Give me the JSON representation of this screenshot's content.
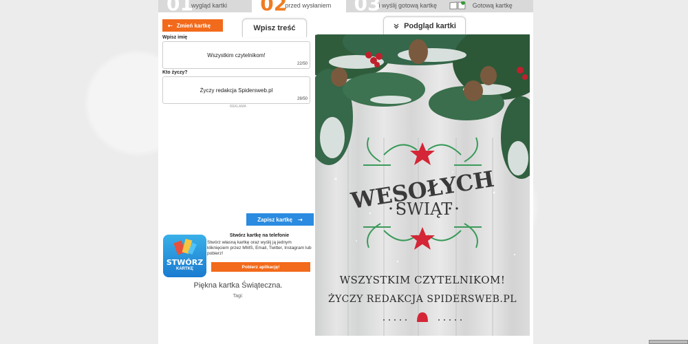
{
  "steps": [
    {
      "num": "01",
      "label": "wygląd kartki"
    },
    {
      "num": "02",
      "label": "przed wysłaniem"
    },
    {
      "num": "03",
      "label": "i wyślij gotową kartkę"
    },
    {
      "num": "",
      "label": "Gotową kartkę"
    }
  ],
  "left": {
    "change_button": "Zmień kartkę",
    "write_tab": "Wpisz treść",
    "name_label": "Wpisz imię",
    "name_value": "Wszystkim czytelnikom!",
    "name_count": "22/50",
    "from_label": "Kto życzy?",
    "from_value": "Życzy redakcja Spidersweb.pl",
    "from_count": "28/50",
    "ad_label": "REKLAMA",
    "save_button": "Zapisz kartkę",
    "app_icon_text1": "STWÓRZ",
    "app_icon_text2": "KARTKĘ",
    "app_title": "Stwórz kartkę na telefonie",
    "app_desc": "Stwórz własną kartkę oraz wyślij ją jednym kliknięciem przez MMS, Email, Twitter, Instagram lub pobierz!",
    "app_button": "Pobierz aplikację!",
    "card_name": "Piękna kartka Świąteczna.",
    "tags": "Tagi:"
  },
  "preview": {
    "tab": "Podgląd kartki",
    "title_line1": "WESOŁYCH",
    "title_line2": "ŚWIĄT",
    "wish_line1": "WSZYSTKIM CZYTELNIKOM!",
    "wish_line2": "ŻYCZY REDAKCJA SPIDERSWEB.PL"
  },
  "colors": {
    "accent": "#f26a1b",
    "save": "#2a8be0",
    "step_active": "#f07c21"
  }
}
